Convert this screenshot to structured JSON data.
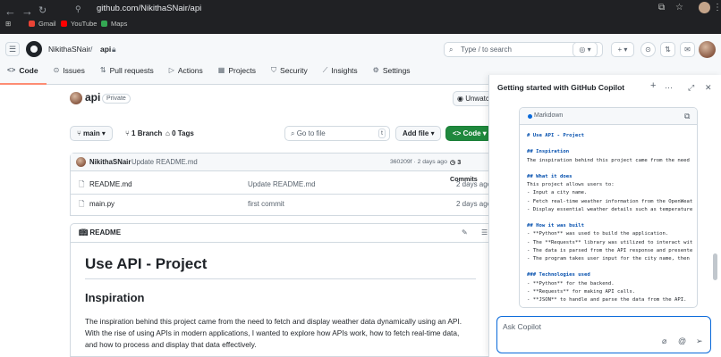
{
  "browser": {
    "url": "github.com/NikithaSNair/api",
    "bookmarks": [
      {
        "label": "Gmail",
        "color": "#ea4335"
      },
      {
        "label": "YouTube",
        "color": "#ff0000"
      },
      {
        "label": "Maps",
        "color": "#34a853"
      }
    ]
  },
  "header": {
    "owner": "NikithaSNair",
    "separator": "/",
    "repo": "api",
    "search_placeholder": "Type / to search",
    "search_key": "/",
    "plus_label": "+ ▾"
  },
  "tabs": [
    {
      "label": "Code",
      "icon": "code-icon",
      "glyph": "<>"
    },
    {
      "label": "Issues",
      "icon": "issues-icon",
      "glyph": "⊙"
    },
    {
      "label": "Pull requests",
      "icon": "pull-request-icon",
      "glyph": "⇅"
    },
    {
      "label": "Actions",
      "icon": "actions-icon",
      "glyph": "▷"
    },
    {
      "label": "Projects",
      "icon": "projects-icon",
      "glyph": "▦"
    },
    {
      "label": "Security",
      "icon": "shield-icon",
      "glyph": "⛉"
    },
    {
      "label": "Insights",
      "icon": "graph-icon",
      "glyph": "⟋"
    },
    {
      "label": "Settings",
      "icon": "gear-icon",
      "glyph": "⚙"
    }
  ],
  "repo": {
    "name": "api",
    "visibility": "Private",
    "watch_label": "Unwatch",
    "branch": "main",
    "branch_count": "1 Branch",
    "tag_count": "0 Tags",
    "goto_placeholder": "Go to file",
    "goto_key": "t",
    "add_file": "Add file",
    "code_button": "Code",
    "last_commit": {
      "author": "NikithaSNair",
      "message": "Update README.md",
      "meta": "360209f · 2 days ago",
      "commits": "3 Commits"
    },
    "files": [
      {
        "name": "README.md",
        "message": "Update README.md",
        "age": "2 days ago"
      },
      {
        "name": "main.py",
        "message": "first commit",
        "age": "2 days ago"
      }
    ],
    "readme_tab": "README"
  },
  "readme": {
    "title": "Use API - Project",
    "h2": "Inspiration",
    "para": [
      "The inspiration behind this project came from the need to fetch and display weather data dynamically using an API.",
      "With the rise of using APIs in modern applications, I wanted to explore how APIs work, how to fetch real-time data,",
      "and how to process and display that data effectively."
    ]
  },
  "copilot": {
    "title": "Getting started with GitHub Copilot",
    "lang": "Markdown",
    "lines": [
      {
        "t": "# Use API - Project",
        "h": true
      },
      {
        "t": "",
        "h": false
      },
      {
        "t": "## Inspiration",
        "h": true
      },
      {
        "t": "The inspiration behind this project came from the need",
        "h": false
      },
      {
        "t": "",
        "h": false
      },
      {
        "t": "## What it does",
        "h": true
      },
      {
        "t": "This project allows users to:",
        "h": false
      },
      {
        "t": "- Input a city name.",
        "h": false
      },
      {
        "t": "- Fetch real-time weather information from the OpenWeat",
        "h": false
      },
      {
        "t": "- Display essential weather details such as temperature",
        "h": false
      },
      {
        "t": "",
        "h": false
      },
      {
        "t": "## How it was built",
        "h": true
      },
      {
        "t": "- **Python** was used to build the application.",
        "h": false
      },
      {
        "t": "- The **Requests** library was utilized to interact wit",
        "h": false
      },
      {
        "t": "- The data is parsed from the API response and presente",
        "h": false
      },
      {
        "t": "- The program takes user input for the city name, then",
        "h": false
      },
      {
        "t": "",
        "h": false
      },
      {
        "t": "### Technologies used",
        "h": true
      },
      {
        "t": "- **Python** for the backend.",
        "h": false
      },
      {
        "t": "- **Requests** for making API calls.",
        "h": false
      },
      {
        "t": "- **JSON** to handle and parse the data from the API.",
        "h": false
      }
    ],
    "ask_placeholder": "Ask Copilot"
  }
}
